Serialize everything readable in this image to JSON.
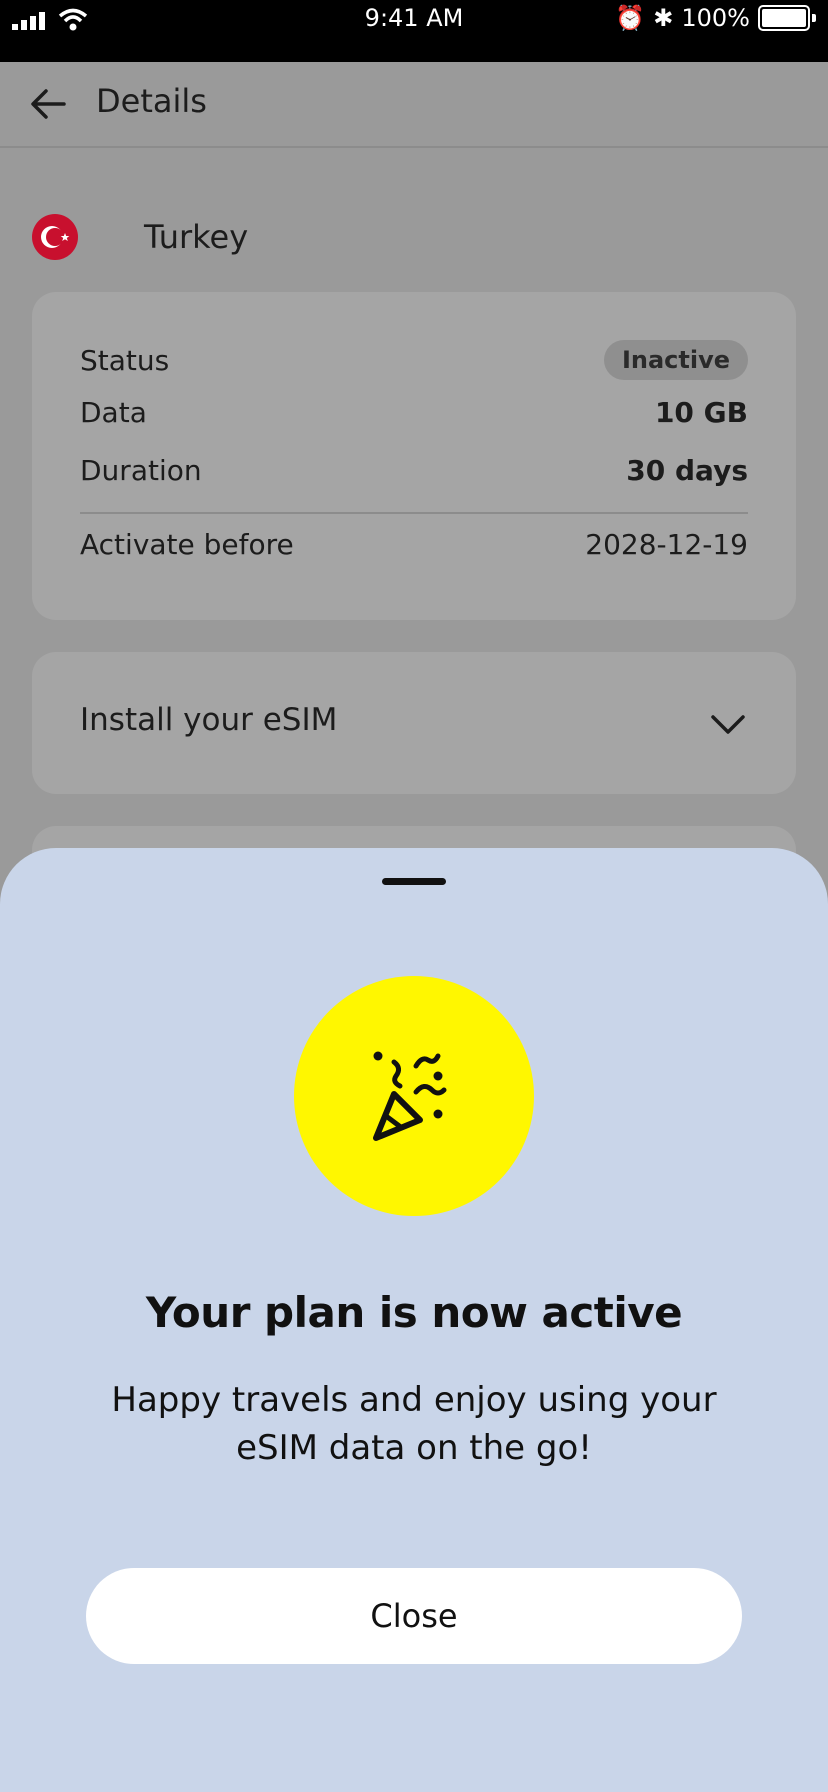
{
  "status_bar": {
    "time": "9:41 AM",
    "battery": "100%"
  },
  "header": {
    "title": "Details"
  },
  "country": {
    "name": "Turkey"
  },
  "details": {
    "status_label": "Status",
    "status_value": "Inactive",
    "data_label": "Data",
    "data_value": "10 GB",
    "duration_label": "Duration",
    "duration_value": "30 days",
    "activate_label": "Activate before",
    "activate_value": "2028-12-19"
  },
  "install": {
    "label": "Install your eSIM"
  },
  "sheet": {
    "title": "Your plan is now active",
    "message": "Happy travels and enjoy using your eSIM data on the go!",
    "close_label": "Close"
  },
  "colors": {
    "accent": "#fff700",
    "sheet_bg": "#c9d5e9",
    "flag_red": "#c8102e"
  }
}
